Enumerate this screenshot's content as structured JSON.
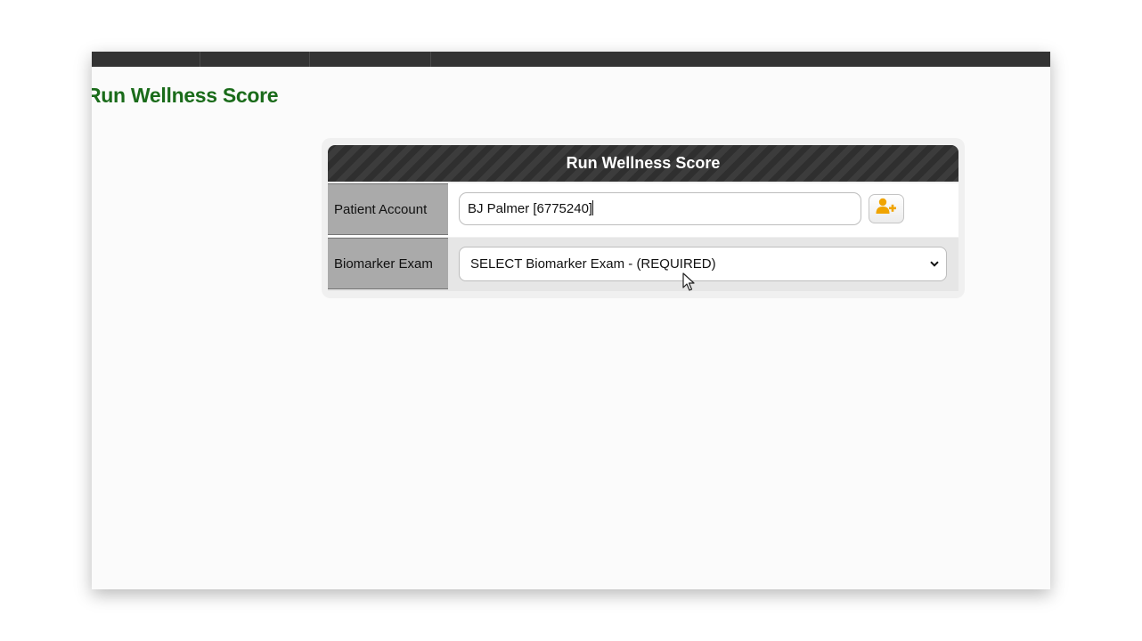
{
  "nav": {
    "tabs": [
      "",
      "",
      "",
      ""
    ]
  },
  "page": {
    "title": "Run Wellness Score"
  },
  "panel": {
    "title": "Run Wellness Score",
    "rows": {
      "patient_account": {
        "label": "Patient Account",
        "value": "BJ Palmer [6775240]",
        "add_button_icon": "add-user-icon"
      },
      "biomarker_exam": {
        "label": "Biomarker Exam",
        "selected": "SELECT Biomarker Exam - (REQUIRED)",
        "dropdown_icon": "chevron-down-icon"
      }
    }
  },
  "colors": {
    "title_green": "#1a6b1a",
    "nav_bg": "#333333",
    "add_icon_orange": "#f0a400"
  }
}
